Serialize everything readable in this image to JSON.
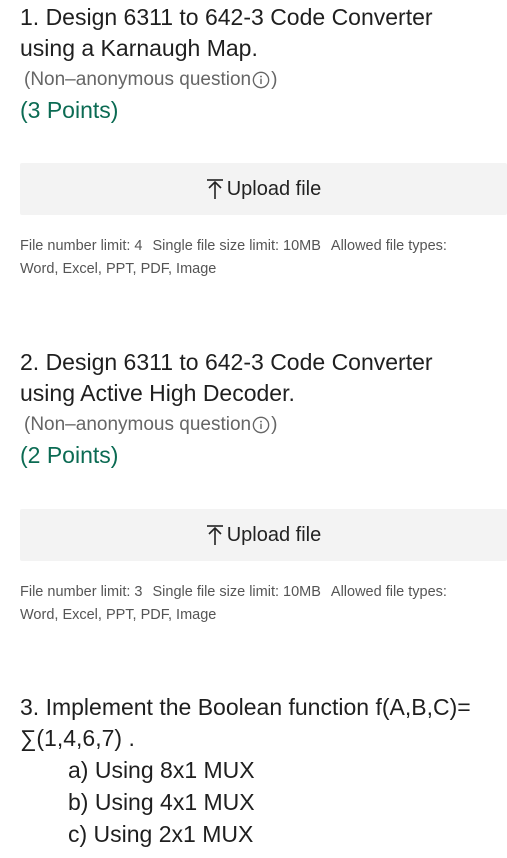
{
  "questions": [
    {
      "title_line1": "1. Design 6311 to 642-3  Code Converter",
      "title_line2": "using a Karnaugh Map.",
      "meta": "(Non–anonymous question",
      "meta_close": ")",
      "points": "(3 Points)",
      "upload_label": "Upload file",
      "limits_line1_a": "File number limit: 4",
      "limits_line1_b": "Single file size limit: 10MB",
      "limits_line1_c": "Allowed file types:",
      "limits_line2": "Word, Excel, PPT, PDF, Image"
    },
    {
      "title_line1": "2. Design 6311 to 642-3  Code Converter",
      "title_line2": "using Active High Decoder.",
      "meta": "(Non–anonymous question",
      "meta_close": ")",
      "points": "(2 Points)",
      "upload_label": "Upload file",
      "limits_line1_a": "File number limit: 3",
      "limits_line1_b": "Single file size limit: 10MB",
      "limits_line1_c": "Allowed file types:",
      "limits_line2": "Word, Excel, PPT, PDF, Image"
    },
    {
      "title_line1": "3. Implement the Boolean function  f(A,B,C)=",
      "title_line2": "∑(1,4,6,7) .",
      "sub_items": [
        "a) Using 8x1 MUX",
        "b) Using 4x1 MUX",
        "c) Using 2x1 MUX"
      ]
    }
  ],
  "icons": {
    "info": "info-icon",
    "upload": "upload-icon"
  },
  "colors": {
    "points": "#0b6b53",
    "upload_bg": "#f3f3f3"
  }
}
